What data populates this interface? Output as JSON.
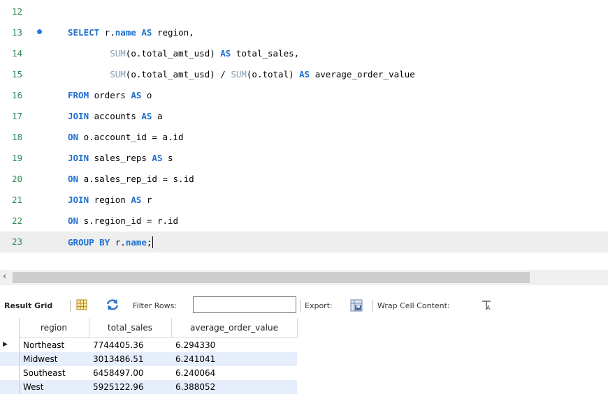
{
  "editor": {
    "lines": [
      {
        "num": "12",
        "tokens": []
      },
      {
        "num": "13",
        "tokens": [
          {
            "t": "SELECT",
            "c": "kw"
          },
          {
            "t": " r."
          },
          {
            "t": "name",
            "c": "kw"
          },
          {
            "t": " "
          },
          {
            "t": "AS",
            "c": "kw"
          },
          {
            "t": " region,"
          }
        ]
      },
      {
        "num": "14",
        "tokens": [
          {
            "t": "        "
          },
          {
            "t": "SUM",
            "c": "fn"
          },
          {
            "t": "(o.total_amt_usd) "
          },
          {
            "t": "AS",
            "c": "kw"
          },
          {
            "t": " total_sales,"
          }
        ]
      },
      {
        "num": "15",
        "tokens": [
          {
            "t": "        "
          },
          {
            "t": "SUM",
            "c": "fn"
          },
          {
            "t": "(o.total_amt_usd) / "
          },
          {
            "t": "SUM",
            "c": "fn"
          },
          {
            "t": "(o.total) "
          },
          {
            "t": "AS",
            "c": "kw"
          },
          {
            "t": " average_order_value"
          }
        ]
      },
      {
        "num": "16",
        "tokens": [
          {
            "t": "FROM",
            "c": "kw"
          },
          {
            "t": " orders "
          },
          {
            "t": "AS",
            "c": "kw"
          },
          {
            "t": " o"
          }
        ]
      },
      {
        "num": "17",
        "tokens": [
          {
            "t": "JOIN",
            "c": "kw"
          },
          {
            "t": " accounts "
          },
          {
            "t": "AS",
            "c": "kw"
          },
          {
            "t": " a"
          }
        ]
      },
      {
        "num": "18",
        "tokens": [
          {
            "t": "ON",
            "c": "kw"
          },
          {
            "t": " o.account_id = a.id"
          }
        ]
      },
      {
        "num": "19",
        "tokens": [
          {
            "t": "JOIN",
            "c": "kw"
          },
          {
            "t": " sales_reps "
          },
          {
            "t": "AS",
            "c": "kw"
          },
          {
            "t": " s"
          }
        ]
      },
      {
        "num": "20",
        "tokens": [
          {
            "t": "ON",
            "c": "kw"
          },
          {
            "t": " a.sales_rep_id = s.id"
          }
        ]
      },
      {
        "num": "21",
        "tokens": [
          {
            "t": "JOIN",
            "c": "kw"
          },
          {
            "t": " region "
          },
          {
            "t": "AS",
            "c": "kw"
          },
          {
            "t": " r"
          }
        ]
      },
      {
        "num": "22",
        "tokens": [
          {
            "t": "ON",
            "c": "kw"
          },
          {
            "t": " s.region_id = r.id"
          }
        ]
      },
      {
        "num": "23",
        "tokens": [
          {
            "t": "GROUP BY",
            "c": "kw"
          },
          {
            "t": " r."
          },
          {
            "t": "name",
            "c": "kw"
          },
          {
            "t": ";"
          }
        ]
      }
    ],
    "marker_line": "13",
    "current_line": "23"
  },
  "toolbar": {
    "result_grid": "Result Grid",
    "filter_rows": "Filter Rows:",
    "filter_value": "",
    "export": "Export:",
    "wrap_cell": "Wrap Cell Content:",
    "icons": [
      "grid-layout-icon",
      "refresh-icon",
      "export-icon",
      "wrap-text-icon"
    ]
  },
  "results": {
    "columns": [
      "region",
      "total_sales",
      "average_order_value"
    ],
    "rows": [
      [
        "Northeast",
        "7744405.36",
        "6.294330"
      ],
      [
        "Midwest",
        "3013486.51",
        "6.241041"
      ],
      [
        "Southeast",
        "6458497.00",
        "6.240064"
      ],
      [
        "West",
        "5925122.96",
        "6.388052"
      ]
    ],
    "selected_row": 0
  },
  "colors": {
    "keyword": "#1f6fd0",
    "function": "#8aa0b8",
    "line_number": "#2e8b57",
    "row_alt": "#e6eefb"
  }
}
